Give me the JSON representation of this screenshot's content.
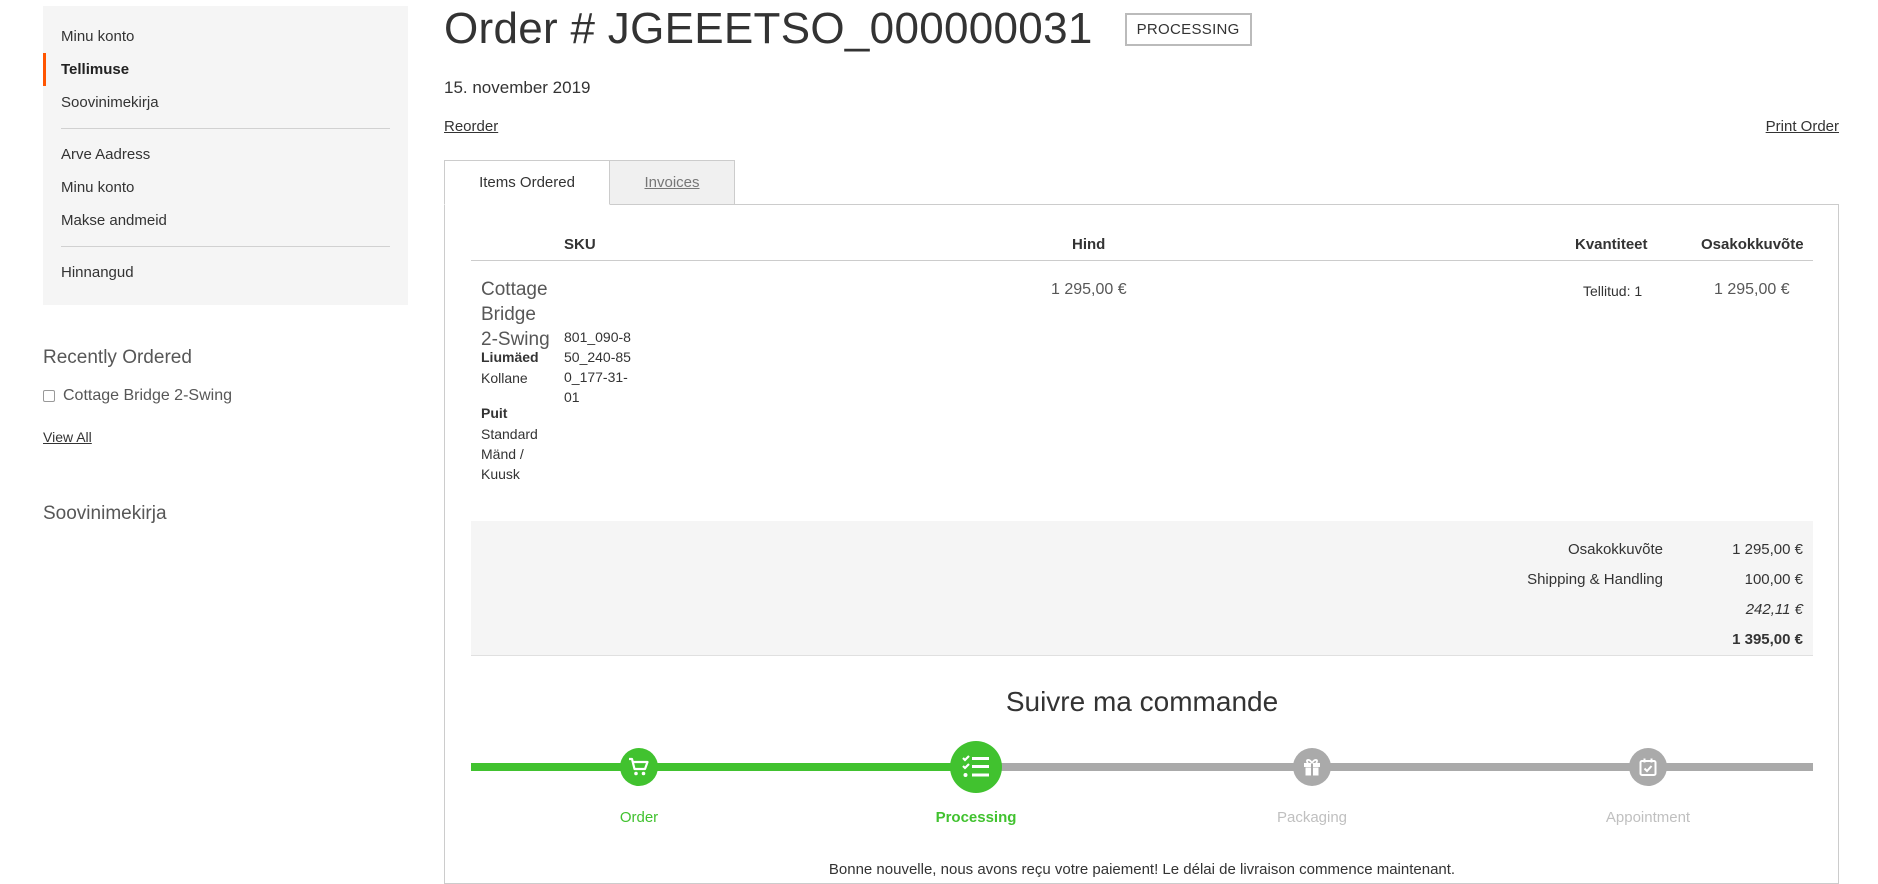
{
  "sidebar": {
    "nav_group_1": [
      "Minu konto",
      "Tellimuse",
      "Soovinimekirja"
    ],
    "nav_group_2": [
      "Arve Aadress",
      "Minu konto",
      "Makse andmeid"
    ],
    "nav_group_3": [
      "Hinnangud"
    ],
    "active_item": "Tellimuse",
    "accent_color": "#ff5501",
    "recently_ordered": {
      "title": "Recently Ordered",
      "items": [
        "Cottage Bridge 2-Swing"
      ],
      "view_all": "View All"
    },
    "wishlist_title": "Soovinimekirja"
  },
  "order": {
    "title": "Order # JGEEETSO_000000031",
    "status": "PROCESSING",
    "date": "15. november 2019",
    "reorder": "Reorder",
    "print": "Print Order"
  },
  "tabs": {
    "items_ordered": "Items Ordered",
    "invoices": "Invoices"
  },
  "table": {
    "headers": {
      "sku": "SKU",
      "price": "Hind",
      "qty": "Kvantiteet",
      "subtotal": "Osakokkuvõte"
    },
    "item": {
      "name": "Cottage Bridge 2-Swing",
      "options": [
        {
          "label": "Liumäed",
          "value": "Kollane"
        },
        {
          "label": "Puit",
          "value": "Standard Mänd / Kuusk"
        }
      ],
      "sku": "801_090-850_240-850_177-31-01",
      "price": "1 295,00 €",
      "qty": "Tellitud: 1",
      "subtotal": "1 295,00 €"
    }
  },
  "totals": {
    "subtotal_label": "Osakokkuvõte",
    "subtotal_value": "1 295,00 €",
    "shipping_label": "Shipping & Handling",
    "shipping_value": "100,00 €",
    "tax_value": "242,11 €",
    "grand_value": "1 395,00 €"
  },
  "tracking": {
    "title": "Suivre ma commande",
    "progress_color": "#41c22f",
    "pending_color": "#aaaaaa",
    "current_step": 2,
    "steps": [
      {
        "label": "Order",
        "icon": "cart-icon"
      },
      {
        "label": "Processing",
        "icon": "checklist-icon"
      },
      {
        "label": "Packaging",
        "icon": "gift-icon"
      },
      {
        "label": "Appointment",
        "icon": "calendar-check-icon"
      }
    ],
    "message": "Bonne nouvelle, nous avons reçu votre paiement! Le délai de livraison commence maintenant."
  }
}
